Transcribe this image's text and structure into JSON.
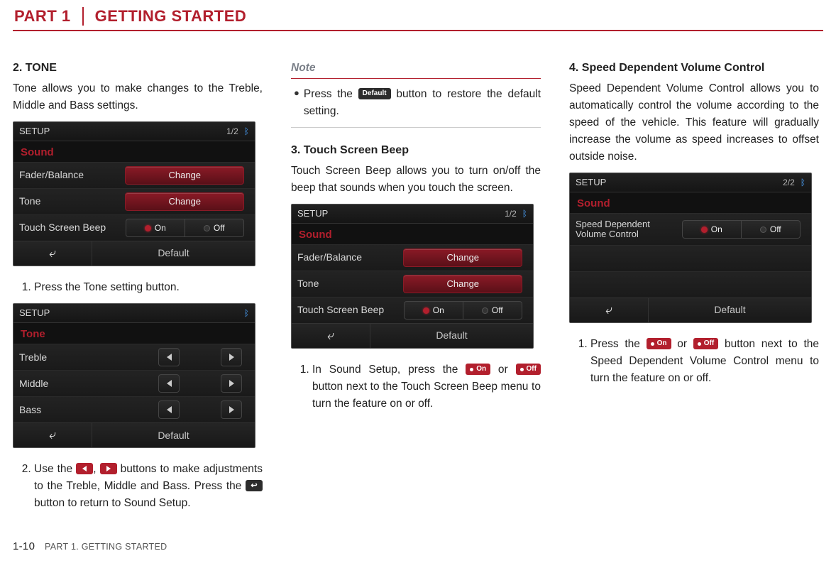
{
  "header": {
    "part": "PART 1",
    "title": "GETTING STARTED"
  },
  "footer": {
    "page_number": "1-10",
    "label": "PART 1. GETTING STARTED"
  },
  "col1": {
    "h_tone": "2. TONE",
    "p_tone": "Tone allows you to make changes to the Treble, Middle and Bass settings.",
    "step1": "Press the Tone setting button.",
    "step2_a": "Use the ",
    "step2_b": ", ",
    "step2_c": " buttons to make adjustments to the Treble, Middle and Bass. Press the ",
    "step2_d": " button to return to Sound Setup."
  },
  "col2": {
    "note_label": "Note",
    "note_a": "Press the ",
    "note_b": " button to restore the default setting.",
    "h_beep": "3. Touch Screen Beep",
    "p_beep": "Touch Screen Beep allows you to turn on/off the beep that sounds when you touch the screen.",
    "step1_a": "In Sound Setup, press the ",
    "step1_b": " or ",
    "step1_c": " button next to the Touch Screen Beep menu to turn the feature on or off."
  },
  "col3": {
    "h_sdvc": "4. Speed Dependent Volume Control",
    "p_sdvc": "Speed Dependent Volume Control allows you to automatically control the volume according to the speed of the vehicle. This feature will gradually increase the volume as speed increases to offset outside noise.",
    "step1_a": "Press the ",
    "step1_b": " or ",
    "step1_c": " button next to the Speed Dependent Volume Control menu to turn the feature on or off."
  },
  "badges": {
    "default": "Default",
    "on": "On",
    "off": "Off"
  },
  "shot1": {
    "title": "SETUP",
    "page": "1/2",
    "sub": "Sound",
    "rows": {
      "fader": "Fader/Balance",
      "tone": "Tone",
      "beep": "Touch Screen Beep",
      "change": "Change",
      "on": "On",
      "off": "Off",
      "default": "Default"
    }
  },
  "shot2": {
    "title": "SETUP",
    "sub": "Tone",
    "rows": {
      "treble": "Treble",
      "middle": "Middle",
      "bass": "Bass",
      "default": "Default"
    }
  },
  "shot3": {
    "title": "SETUP",
    "page": "1/2",
    "sub": "Sound",
    "rows": {
      "fader": "Fader/Balance",
      "tone": "Tone",
      "beep": "Touch Screen Beep",
      "change": "Change",
      "on": "On",
      "off": "Off",
      "default": "Default"
    }
  },
  "shot4": {
    "title": "SETUP",
    "page": "2/2",
    "sub": "Sound",
    "rows": {
      "sdvc1": "Speed Dependent",
      "sdvc2": "Volume Control",
      "on": "On",
      "off": "Off",
      "default": "Default"
    }
  }
}
